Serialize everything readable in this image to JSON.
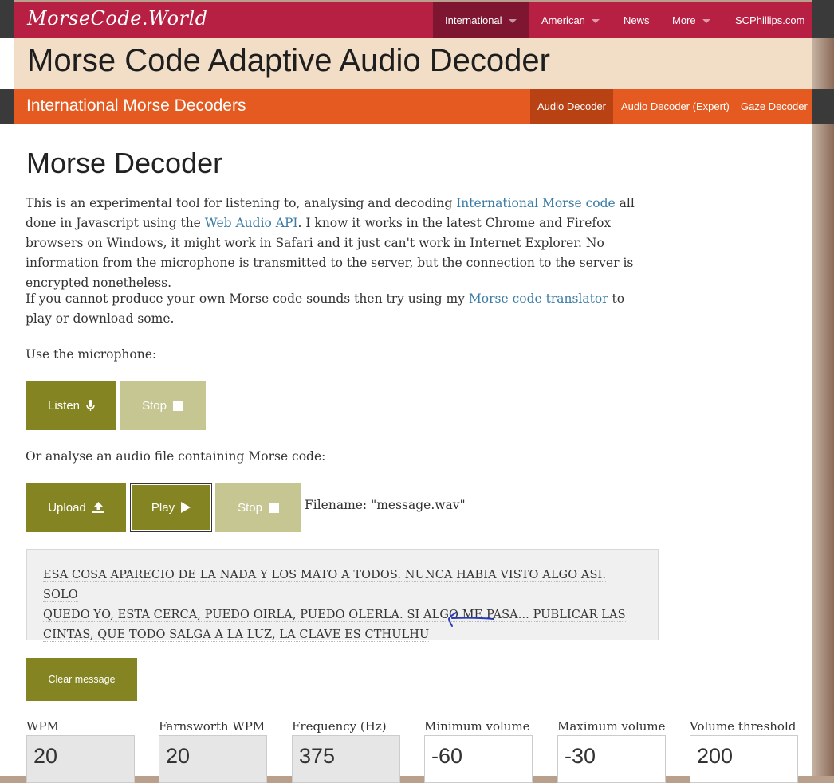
{
  "topnav": {
    "logo": "MorseCode.World",
    "items": [
      {
        "label": "International"
      },
      {
        "label": "American"
      },
      {
        "label": "News"
      },
      {
        "label": "More"
      },
      {
        "label": "SCPhillips.com"
      }
    ]
  },
  "banner": {
    "title": "Morse Code Adaptive Audio Decoder"
  },
  "subnav": {
    "title": "International Morse Decoders",
    "items": [
      {
        "label": "Audio Decoder"
      },
      {
        "label": "Audio Decoder (Expert)"
      },
      {
        "label": "Gaze Decoder"
      }
    ]
  },
  "main": {
    "heading": "Morse Decoder",
    "intro": {
      "t1": "This is an experimental tool for listening to, analysing and decoding ",
      "link1": "International Morse code",
      "t2": " all done in Javascript using the ",
      "link2": "Web Audio API",
      "t3": ". I know it works in the latest Chrome and Firefox browsers on Windows, it might work in Safari and it just can't work in Internet Explorer. No information from the microphone is transmitted to the server, but the connection to the server is encrypted nonetheless."
    },
    "translator": {
      "t1": "If you cannot produce your own Morse code sounds then try using my ",
      "link": "Morse code translator",
      "t2": " to play or download some."
    },
    "mic_label": "Use the microphone:",
    "listen_label": "Listen",
    "stop_label": "Stop",
    "file_label": "Or analyse an audio file containing Morse code:",
    "upload_label": "Upload",
    "play_label": "Play",
    "stop2_label": "Stop",
    "filename": "Filename: \"message.wav\"",
    "message_lines": [
      "ESA COSA APARECIO DE LA NADA Y LOS MATO A TODOS. NUNCA HABIA VISTO ALGO ASI. SOLO",
      "QUEDO YO, ESTA CERCA, PUEDO OIRLA, PUEDO OLERLA. SI ALGO ME PASA... PUBLICAR LAS",
      "CINTAS, QUE TODO SALGA A LA LUZ, LA CLAVE ES CTHULHU"
    ],
    "clear_label": "Clear message"
  },
  "settings": [
    {
      "label": "WPM",
      "value": "20"
    },
    {
      "label": "Farnsworth WPM",
      "value": "20"
    },
    {
      "label": "Frequency (Hz)",
      "value": "375"
    },
    {
      "label": "Minimum volume",
      "value": "-60"
    },
    {
      "label": "Maximum volume",
      "value": "-30"
    },
    {
      "label": "Volume threshold",
      "value": "200"
    }
  ],
  "colors": {
    "nav": "#b82043",
    "banner": "#f2dec6",
    "subnav": "#e45a20",
    "button": "#858422",
    "button_disabled": "#c6c693",
    "link": "#3a7ca5",
    "annotation": "#2a3ab8"
  }
}
